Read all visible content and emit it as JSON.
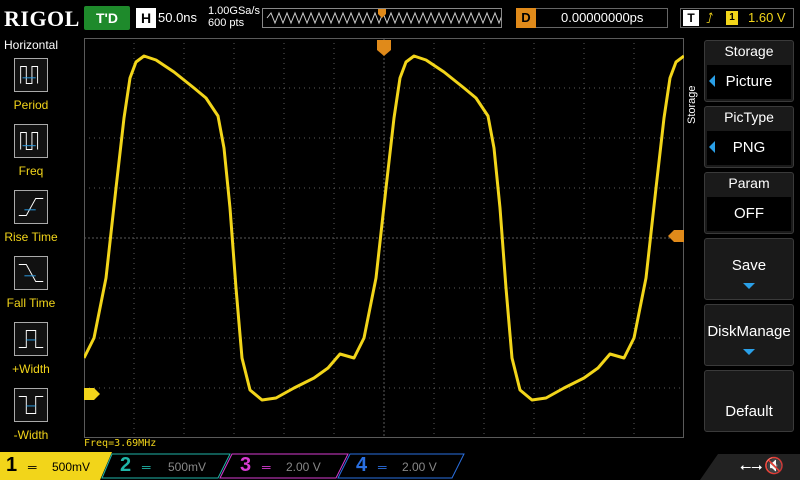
{
  "top": {
    "brand": "RIGOL",
    "trigger_status": "T'D",
    "timebase_label": "H",
    "timebase": "50.0ns",
    "sample_rate": "1.00GSa/s",
    "memory_depth": "600 pts",
    "delay_label": "D",
    "delay": "0.00000000ps",
    "trigger_label": "T",
    "trigger_source": "1",
    "trigger_level": "1.60 V"
  },
  "left_menu": {
    "title": "Horizontal",
    "items": [
      {
        "label": "Period",
        "icon": "period-measure-icon"
      },
      {
        "label": "Freq",
        "icon": "frequency-measure-icon"
      },
      {
        "label": "Rise Time",
        "icon": "rise-time-icon"
      },
      {
        "label": "Fall Time",
        "icon": "fall-time-icon"
      },
      {
        "label": "+Width",
        "icon": "positive-width-icon"
      },
      {
        "label": "-Width",
        "icon": "negative-width-icon"
      }
    ]
  },
  "right_menu": {
    "side_title": "Storage",
    "items": [
      {
        "label": "Storage",
        "value": "Picture"
      },
      {
        "label": "PicType",
        "value": "PNG"
      },
      {
        "label": "Param",
        "value": "OFF"
      },
      {
        "label": "Save"
      },
      {
        "label": "DiskManage"
      },
      {
        "label": "Default"
      }
    ]
  },
  "measurement": "Freq=3.69MHz",
  "channels": [
    {
      "num": "1",
      "scale": "500mV",
      "color": "#f2d51a",
      "active": true
    },
    {
      "num": "2",
      "scale": "500mV",
      "color": "#1fb5a8",
      "active": false
    },
    {
      "num": "3",
      "scale": "2.00 V",
      "color": "#d63bd1",
      "active": false
    },
    {
      "num": "4",
      "scale": "2.00 V",
      "color": "#2a6fe0",
      "active": false
    }
  ],
  "colors": {
    "trace": "#f2d51a",
    "trigger_marker": "#e08a1a",
    "grid": "#5a5a5a"
  }
}
